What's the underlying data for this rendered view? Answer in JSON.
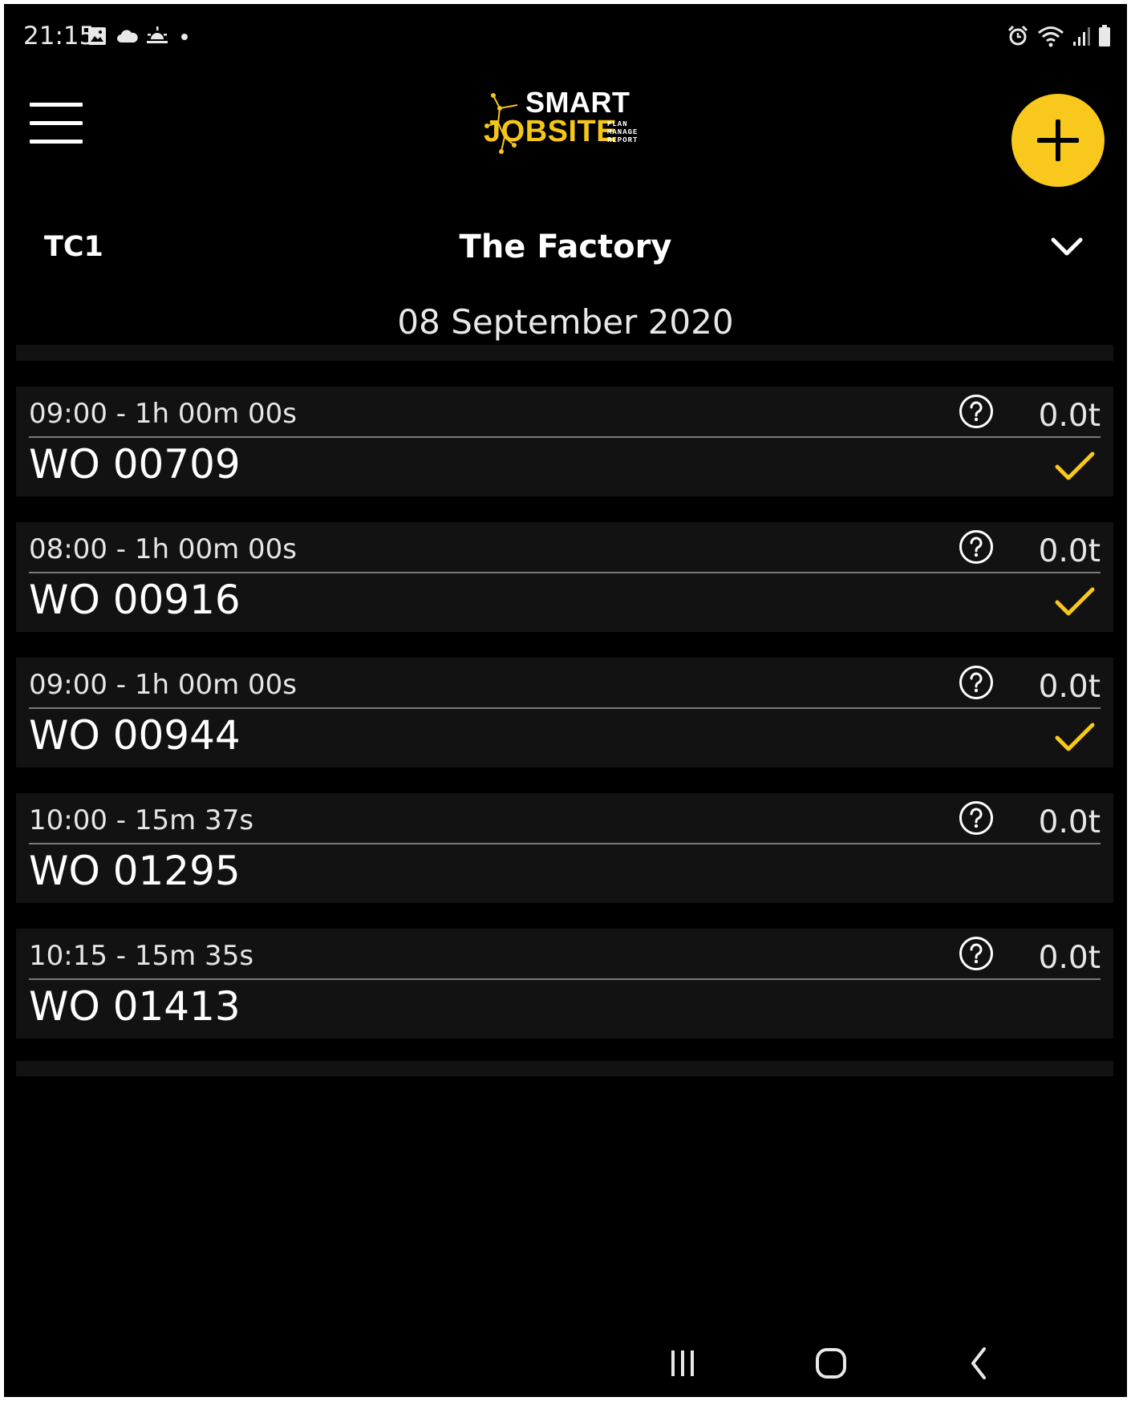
{
  "status_bar": {
    "time": "21:15",
    "left_icons": [
      "gallery-icon",
      "cloud-icon",
      "sunrise-icon",
      "dot-icon"
    ],
    "right_icons": [
      "alarm-icon",
      "wifi-icon",
      "signal-icon",
      "battery-icon"
    ]
  },
  "header": {
    "menu_icon": "hamburger-menu-icon",
    "logo": {
      "line1": "SMART",
      "line2": "JOBSITE",
      "tagline": [
        "PLAN",
        "MANAGE",
        "REPORT"
      ]
    },
    "add_icon": "plus-icon"
  },
  "site": {
    "code": "TC1",
    "name": "The Factory",
    "dropdown_icon": "chevron-down-icon"
  },
  "date": "08 September 2020",
  "work_orders": [
    {
      "time": "09:00 - 1h 00m 00s",
      "wo": "WO 00709",
      "weight": "0.0t",
      "completed": true
    },
    {
      "time": "08:00 - 1h 00m 00s",
      "wo": "WO 00916",
      "weight": "0.0t",
      "completed": true
    },
    {
      "time": "09:00 - 1h 00m 00s",
      "wo": "WO 00944",
      "weight": "0.0t",
      "completed": true
    },
    {
      "time": "10:00 - 15m 37s",
      "wo": "WO 01295",
      "weight": "0.0t",
      "completed": false
    },
    {
      "time": "10:15 - 15m 35s",
      "wo": "WO 01413",
      "weight": "0.0t",
      "completed": false
    }
  ],
  "colors": {
    "accent": "#f8c81c",
    "background": "#000000",
    "card": "#121212"
  },
  "nav": [
    "recent-apps-icon",
    "home-icon",
    "back-icon"
  ]
}
